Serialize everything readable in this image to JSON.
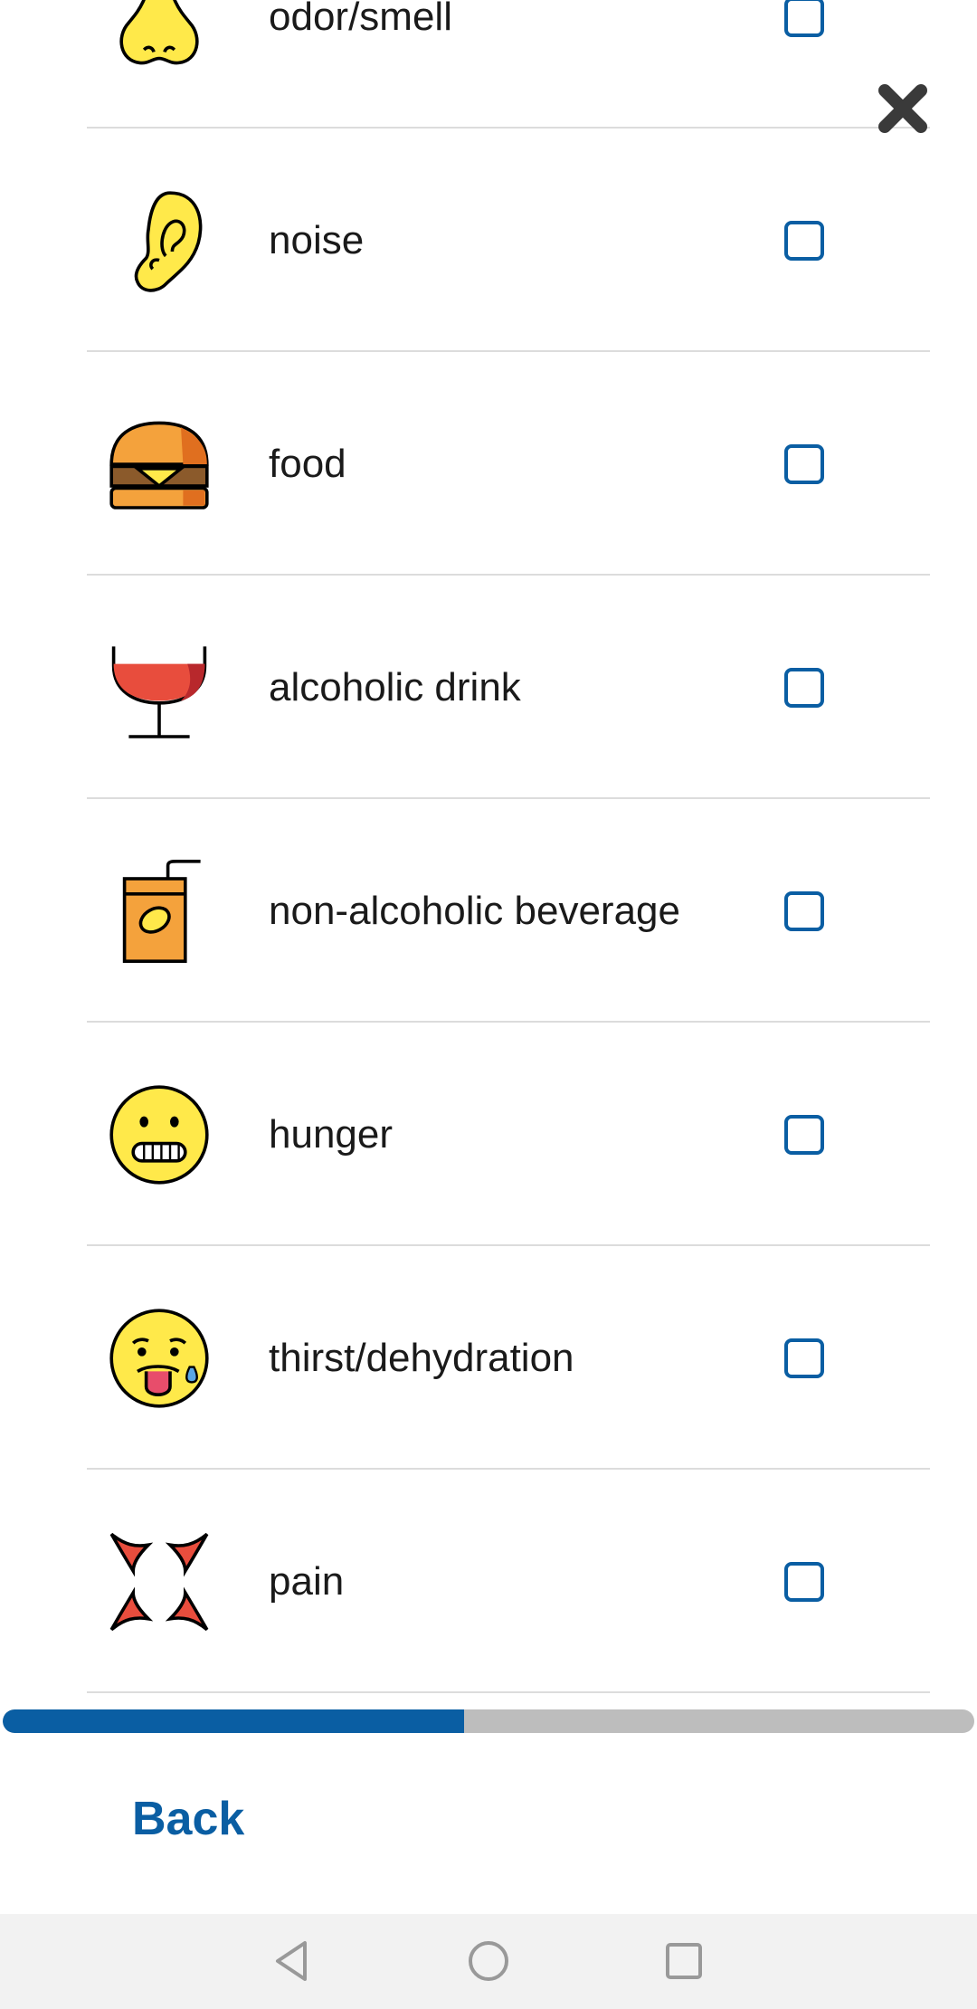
{
  "items": [
    {
      "label": "odor/smell",
      "icon": "nose-icon",
      "checked": false
    },
    {
      "label": "noise",
      "icon": "ear-icon",
      "checked": false
    },
    {
      "label": "food",
      "icon": "burger-icon",
      "checked": false
    },
    {
      "label": "alcoholic drink",
      "icon": "wine-glass-icon",
      "checked": false
    },
    {
      "label": "non-alcoholic beverage",
      "icon": "juice-box-icon",
      "checked": false
    },
    {
      "label": "hunger",
      "icon": "grimacing-face-icon",
      "checked": false
    },
    {
      "label": "thirst/dehydration",
      "icon": "tongue-out-sweat-face-icon",
      "checked": false
    },
    {
      "label": "pain",
      "icon": "anger-symbol-icon",
      "checked": false
    }
  ],
  "progress": {
    "fraction": 0.475
  },
  "footer": {
    "back_label": "Back"
  },
  "colors": {
    "accent": "#0a5ea3",
    "divider": "#dcdcdc",
    "track": "#bdbdbd"
  },
  "navbar": {
    "icons": [
      "back-triangle-icon",
      "home-circle-icon",
      "recents-square-icon"
    ]
  }
}
